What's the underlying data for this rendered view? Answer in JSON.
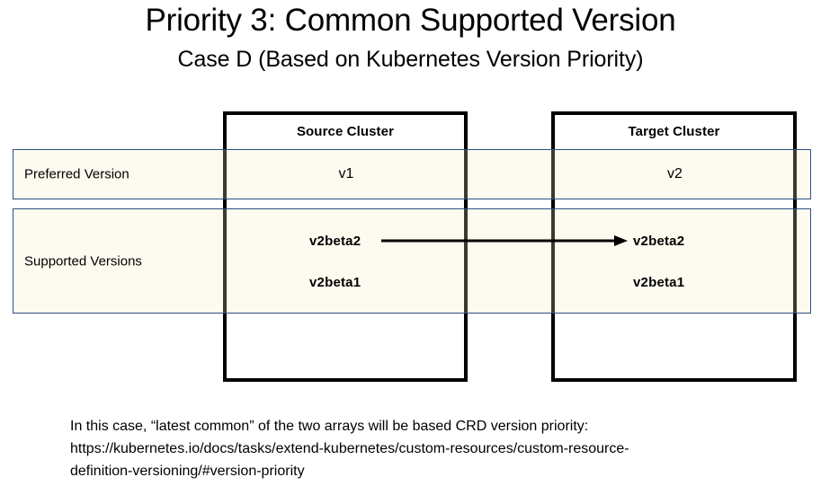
{
  "slide": {
    "title": "Priority 3: Common Supported Version",
    "subtitle": "Case D (Based on Kubernetes Version Priority)"
  },
  "colors": {
    "row_fill": "#FDFAEF",
    "row_border": "#2E4F82",
    "box_border": "#000000",
    "arrow": "#000000",
    "text": "#000000"
  },
  "clusters": {
    "source": {
      "title": "Source Cluster"
    },
    "target": {
      "title": "Target Cluster"
    }
  },
  "rows": {
    "preferred": {
      "label": "Preferred Version",
      "source_value": "v1",
      "target_value": "v2"
    },
    "supported": {
      "label": "Supported Versions",
      "source_values": [
        "v2beta2",
        "v2beta1"
      ],
      "target_values": [
        "v2beta2",
        "v2beta1"
      ]
    }
  },
  "arrow": {
    "name": "version-mapping-arrow",
    "from": "v2beta2",
    "to": "v2beta2"
  },
  "caption": {
    "line1": "In this case, “latest common” of the two arrays will be based CRD version priority:",
    "line2": "https://kubernetes.io/docs/tasks/extend-kubernetes/custom-resources/custom-resource-",
    "line3": "definition-versioning/#version-priority"
  }
}
